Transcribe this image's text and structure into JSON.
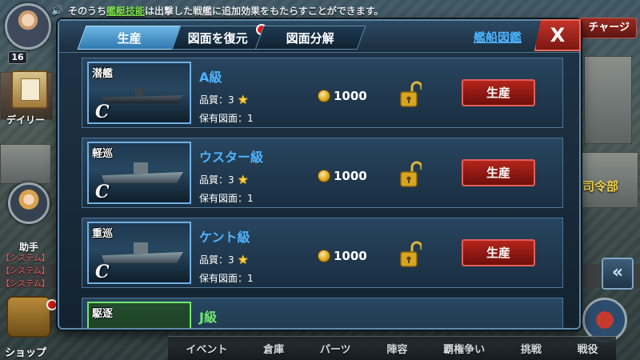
{
  "ticker": {
    "prefix": "そのうち",
    "highlight": "艦艇技能",
    "suffix": "は出撃した戦艦に追加効果をもたらすことができます。"
  },
  "hud": {
    "level": "16",
    "daily_label": "デイリー",
    "assistant_label": "助手",
    "shop_label": "ショップ",
    "charge_label": "チャージ",
    "hq_label": "司令部",
    "collapse_glyph": "«",
    "log_lines": [
      "【システム】",
      "【システム】",
      "【システム】"
    ]
  },
  "bottom_nav": [
    "イベント",
    "倉庫",
    "パーツ",
    "陣容",
    "覇権争い",
    "挑戦",
    "戦役"
  ],
  "modal": {
    "tabs": [
      {
        "label": "生産",
        "active": true
      },
      {
        "label": "図面を復元",
        "active": false
      },
      {
        "label": "図面分解",
        "active": false
      }
    ],
    "catalog_link": "艦船図鑑",
    "close_label": "X",
    "quality_label": "品質：3",
    "blueprint_label": "保有図面：1",
    "produce_label": "生産",
    "ships": [
      {
        "type": "潜艦",
        "rank": "C",
        "name": "A級",
        "cost": "1000",
        "kind": "sub"
      },
      {
        "type": "軽巡",
        "rank": "C",
        "name": "ウスター級",
        "cost": "1000",
        "kind": "cruiser"
      },
      {
        "type": "重巡",
        "rank": "C",
        "name": "ケント級",
        "cost": "1000",
        "kind": "cruiser"
      },
      {
        "type": "駆逐",
        "rank": "",
        "name": "J級",
        "cost": "",
        "kind": "destroyer"
      }
    ]
  },
  "colors": {
    "accent_blue": "#4fb3ff",
    "produce_red": "#b3241c",
    "close_red": "#c2332a",
    "gold": "#ffcf3a"
  }
}
